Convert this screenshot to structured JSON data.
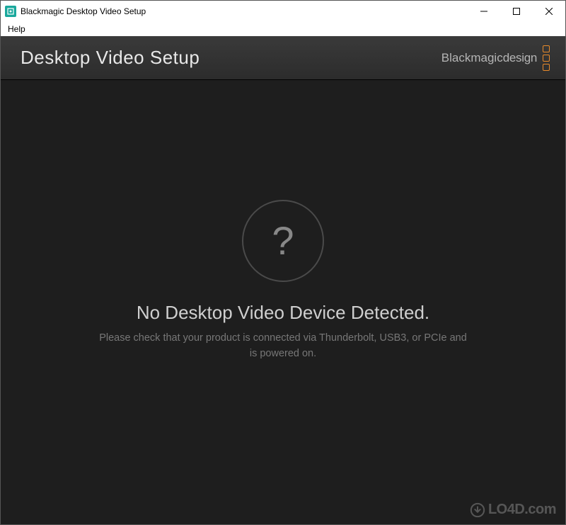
{
  "window": {
    "title": "Blackmagic Desktop Video Setup"
  },
  "menubar": {
    "help": "Help"
  },
  "header": {
    "title": "Desktop Video Setup",
    "brand_light": "Blackmagic",
    "brand_bold": "design"
  },
  "main": {
    "qmark": "?",
    "heading": "No Desktop Video Device Detected.",
    "body": "Please check that your product is connected via Thunderbolt, USB3, or PCIe and is powered on."
  },
  "watermark": {
    "text": "LO4D.com"
  }
}
